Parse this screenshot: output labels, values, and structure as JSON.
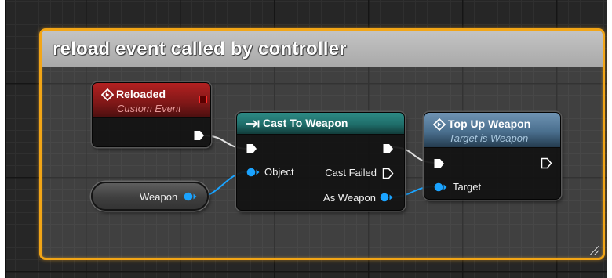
{
  "comment": {
    "title": "reload event called by controller"
  },
  "nodes": {
    "reloaded": {
      "title": "Reloaded",
      "subtitle": "Custom Event",
      "header_color": "#8a1a1a"
    },
    "cast": {
      "title": "Cast To Weapon",
      "object_pin": "Object",
      "cast_failed_pin": "Cast Failed",
      "as_weapon_pin": "As Weapon",
      "header_color": "#1f6e6a"
    },
    "top_up": {
      "title": "Top Up Weapon",
      "subtitle": "Target is Weapon",
      "target_pin": "Target",
      "header_color": "#466c8a"
    },
    "weapon_var": {
      "label": "Weapon"
    }
  },
  "colors": {
    "comment_border": "#f2a516",
    "object_pin": "#1aa3ff",
    "exec_pin": "#ffffff",
    "delegate_square": "#ff2a2a"
  },
  "icons": {
    "event_icon": "diamond-arrow-icon",
    "cast_icon": "arrow-bar-icon",
    "function_icon": "diamond-arrow-icon"
  }
}
